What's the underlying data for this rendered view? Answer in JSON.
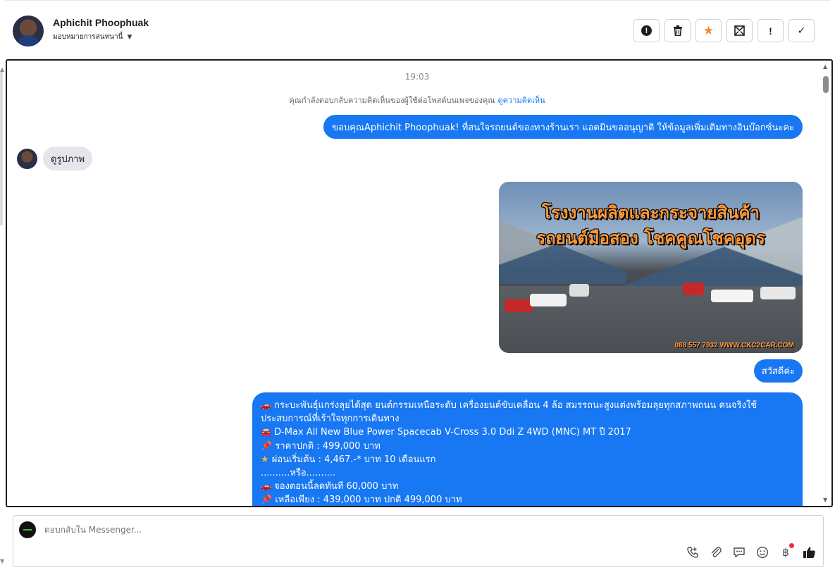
{
  "header": {
    "user_name": "Aphichit Phoophuak",
    "assign_label": "มอบหมายการสนทนานี้",
    "actions": [
      {
        "name": "spam-button",
        "icon": "alert-circle-icon",
        "symbol": "!"
      },
      {
        "name": "delete-button",
        "icon": "trash-icon",
        "symbol": "🗑"
      },
      {
        "name": "star-button",
        "icon": "star-icon",
        "symbol": "★"
      },
      {
        "name": "mark-unread-button",
        "icon": "envelope-icon",
        "symbol": "✉"
      },
      {
        "name": "follow-up-button",
        "icon": "exclamation-icon",
        "symbol": "!"
      },
      {
        "name": "done-button",
        "icon": "check-icon",
        "symbol": "✓"
      }
    ]
  },
  "chat": {
    "timestamp": "19:03",
    "reply_note": "คุณกำลังตอบกลับความคิดเห็นของผู้ใช้ต่อโพสต์บนเพจของคุณ",
    "reply_note_link": "ดูความคิดเห็น",
    "outgoing_1": "ขอบคุณAphichit Phoophuak! ที่สนใจรถยนต์ของทางร้านเรา แอดมินขออนุญาติ ให้ข้อมูลเพิ่มเติมทางอินบ๊อกซ์นะคะ",
    "incoming_1": "ดูรูปภาพ",
    "photo": {
      "title_line1": "โรงงานผลิตและกระจายสินค้า",
      "title_line2": "รถยนต์มือสอง โชคคูณโชคอุดร",
      "contact": "088 557 7932 WWW.CKC2CAR.COM"
    },
    "outgoing_2": "สวัสดีค่ะ",
    "outgoing_3_lines": [
      "กระบะพันธุ์แกร่งลุยได้สุด ยนต์กรรมเหนือระดับ เครื่องยนต์ขับเคลื่อน 4 ล้อ สมรรถนะสูงแต่งพร้อมลุยทุกสภาพถนน คนจริงใช้ ประสบการณ์ที่เร้าใจทุกการเดินทาง",
      "D-Max All New Blue Power Spacecab V-Cross 3.0 Ddi Z 4WD (MNC) MT ปี 2017",
      "ราคาปกติ : 499,000 บาท",
      "ผ่อนเริ่มต้น : 4,467.-* บาท 10 เดือนแรก",
      "..........หรือ..........",
      "จองตอนนี้ลดทันที 60,000 บาท",
      "เหลือเพียง : 439,000 บาท ปกติ 499,000 บาท"
    ],
    "outgoing_3_icons": [
      "car-icon",
      "car-icon",
      "pin-icon",
      "star-icon",
      "",
      "car-icon",
      "pin-icon"
    ]
  },
  "composer": {
    "placeholder": "ตอบกลับใน Messenger...",
    "tools": [
      "phone-icon",
      "paperclip-icon",
      "saved-reply-icon",
      "emoji-icon",
      "baht-icon",
      "like-icon"
    ]
  },
  "colors": {
    "accent": "#1877f2",
    "star": "#f5842a",
    "photo_text": "#ff9a3c"
  }
}
